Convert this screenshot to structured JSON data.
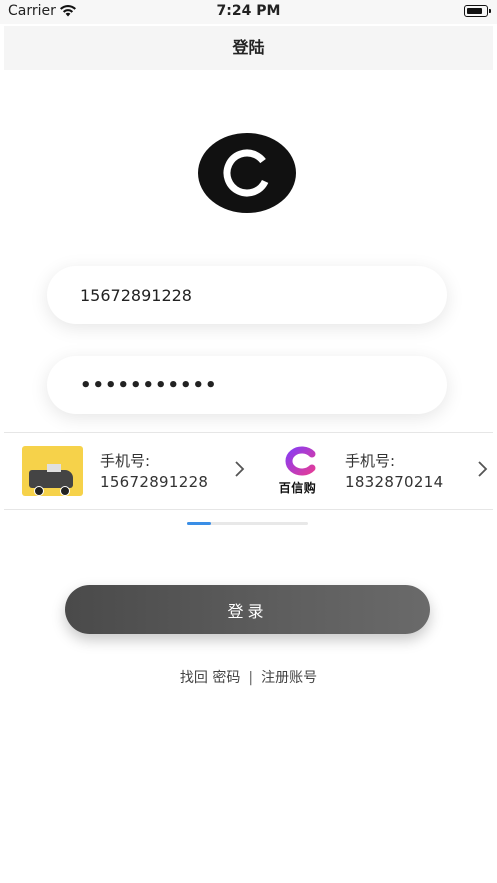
{
  "status_bar": {
    "carrier": "Carrier",
    "time": "7:24 PM"
  },
  "nav": {
    "title": "登陆"
  },
  "logo": {
    "icon": "app-logo-icon",
    "color": "#111111"
  },
  "form": {
    "phone_value": "15672891228",
    "password_value": "•••••••••••"
  },
  "accounts": [
    {
      "icon": "app-thumbnail-icon",
      "label": "手机号:",
      "number": "15672891228"
    },
    {
      "icon": "baixingou-logo-icon",
      "brand": "百信购",
      "label": "手机号:",
      "number": "1832870214"
    }
  ],
  "indicator": {
    "active_fraction": 0.2,
    "accent": "#3a8ee6"
  },
  "login_button": {
    "label": "登录"
  },
  "links": {
    "forgot": "找回 密码",
    "separator": "|",
    "register": "注册账号"
  }
}
